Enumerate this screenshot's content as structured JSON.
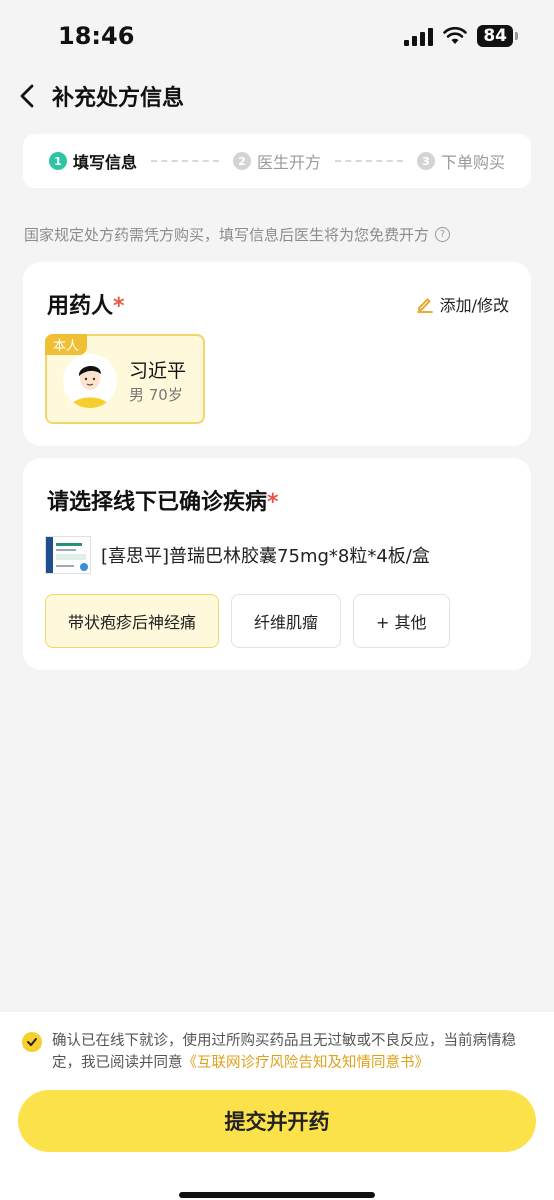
{
  "status_bar": {
    "time": "18:46",
    "battery": "84"
  },
  "nav": {
    "title": "补充处方信息"
  },
  "steps": [
    {
      "num": "1",
      "label": "填写信息"
    },
    {
      "num": "2",
      "label": "医生开方"
    },
    {
      "num": "3",
      "label": "下单购买"
    }
  ],
  "notice": {
    "text": "国家规定处方药需凭方购买，填写信息后医生将为您免费开方",
    "help_symbol": "?"
  },
  "patient_section": {
    "title": "用药人",
    "required_mark": "*",
    "edit_label": "添加/修改",
    "patient": {
      "badge": "本人",
      "name": "习近平",
      "info": "男 70岁"
    }
  },
  "disease_section": {
    "title": "请选择线下已确诊疾病",
    "required_mark": "*",
    "drug_name": "[喜思平]普瑞巴林胶囊75mg*8粒*4板/盒",
    "options": [
      "带状疱疹后神经痛",
      "纤维肌瘤",
      "+ 其他"
    ]
  },
  "agreement": {
    "text": "确认已在线下就诊，使用过所购买药品且无过敏或不良反应，当前病情稳定，我已阅读并同意",
    "link": "《互联网诊疗风险告知及知情同意书》"
  },
  "submit": {
    "label": "提交并开药"
  },
  "colors": {
    "accent": "#fbe14a",
    "step_active": "#2ec4a6",
    "link": "#e0a11b",
    "required": "#e8584a"
  }
}
